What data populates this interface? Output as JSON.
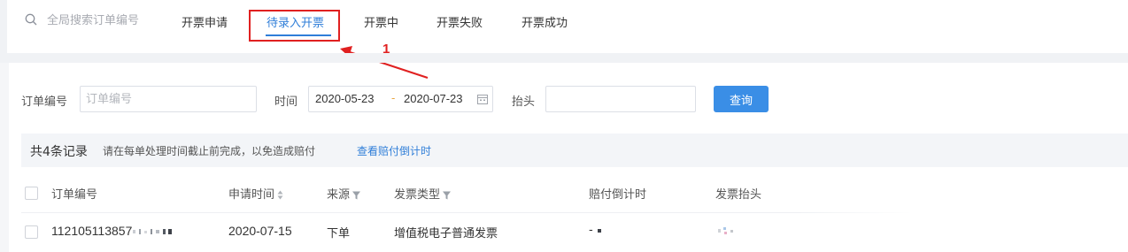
{
  "search": {
    "placeholder": "全局搜索订单编号"
  },
  "tabs": [
    {
      "label": "开票申请"
    },
    {
      "label": "待录入开票",
      "active": true
    },
    {
      "label": "开票中"
    },
    {
      "label": "开票失败"
    },
    {
      "label": "开票成功"
    }
  ],
  "annotation": {
    "number": "1",
    "color": "#e02020"
  },
  "filters": {
    "order_label": "订单编号",
    "order_placeholder": "订单编号",
    "time_label": "时间",
    "date_start": "2020-05-23",
    "date_sep": "-",
    "date_end": "2020-07-23",
    "title_label": "抬头",
    "title_value": "",
    "query_button": "查询"
  },
  "summary": {
    "count": "共4条记录",
    "note": "请在每单处理时间截止前完成，以免造成赔付",
    "link": "查看赔付倒计时"
  },
  "table": {
    "columns": [
      "订单编号",
      "申请时间",
      "来源",
      "发票类型",
      "赔付倒计时",
      "发票抬头"
    ],
    "rows": [
      {
        "order_no": "112105113857",
        "apply_time": "2020-07-15",
        "source": "下单",
        "invoice_type": "增值税电子普通发票",
        "countdown": "-"
      }
    ]
  },
  "colors": {
    "accent": "#2f7ed8",
    "button": "#3a8ee6",
    "highlight": "#e02020"
  }
}
